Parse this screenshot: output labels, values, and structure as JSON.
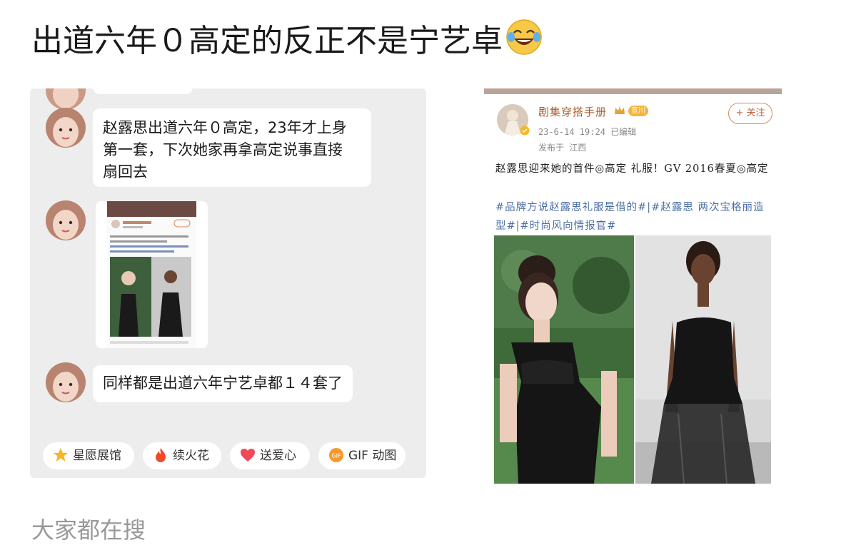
{
  "title": "出道六年０高定的反正不是宁艺卓",
  "chat": {
    "messages": [
      {
        "text_line1": "赵露思出道六年０高定，23年才上身",
        "text_line2": "第一套，下次她家再拿高定说事直接",
        "text_line3": "扇回去"
      },
      {
        "text": "同样都是出道六年宁艺卓都１４套了"
      }
    ],
    "toolbar": [
      {
        "label": "星愿展馆",
        "icon": "star-icon"
      },
      {
        "label": "续火花",
        "icon": "fire-icon"
      },
      {
        "label": "送爱心",
        "icon": "heart-icon"
      },
      {
        "label": "GIF 动图",
        "icon": "gif-icon"
      }
    ]
  },
  "post": {
    "name": "剧集穿搭手册",
    "badge": "宣川",
    "time": "23-6-14 19:24  已编辑",
    "location": "发布于 江西",
    "follow": "+ 关注",
    "text": "赵露思迎来她的首件◎高定 礼服！GV 2016春夏◎高定",
    "tags": "#品牌方说赵露思礼服是借的#|#赵露思 两次宝格丽造型#|#时尚风向情报官#"
  },
  "footer": "大家都在搜",
  "colors": {
    "accent": "#c0603a",
    "tag_blue": "#4b6fa5",
    "chat_bg": "#ededed"
  }
}
